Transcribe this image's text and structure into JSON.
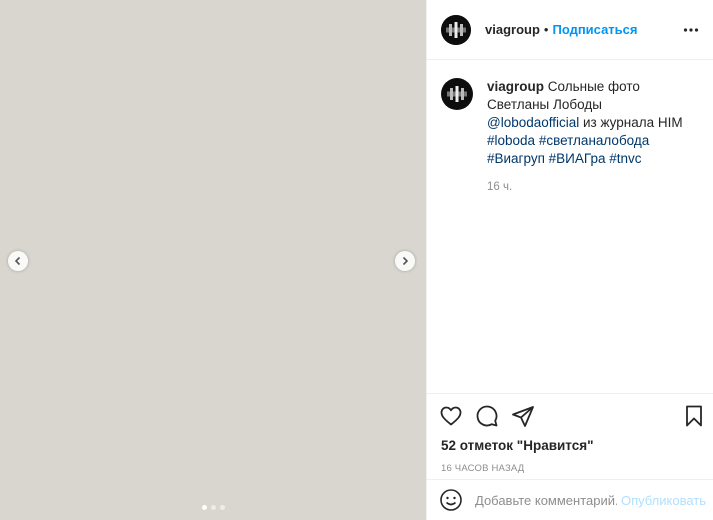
{
  "post": {
    "photo": {
      "icon": "photo-placeholder",
      "slide_count": 3,
      "active_slide": 1
    },
    "author": {
      "username": "viagroup",
      "separator": "•",
      "follow_label": "Подписаться"
    },
    "caption": {
      "username": "viagroup",
      "text_before": " Сольные фото Светланы Лободы ",
      "mention": "@lobodaofficial",
      "text_after": " из журнала HIM ",
      "hashtags": [
        "#loboda",
        "#светланалобода",
        "#Виагруп",
        "#ВИАГра",
        "#tnvc"
      ],
      "time": "16 ч."
    },
    "likes_label": "52 отметок \"Нравится\"",
    "posted_label": "16 ЧАСОВ НАЗАД",
    "comment": {
      "placeholder": "Добавьте комментарий...",
      "publish_label": "Опубликовать"
    },
    "colors": {
      "link": "#00376b",
      "follow": "#0095f6",
      "publish_disabled": "#b2dffc",
      "muted": "#8e8e8e"
    }
  }
}
